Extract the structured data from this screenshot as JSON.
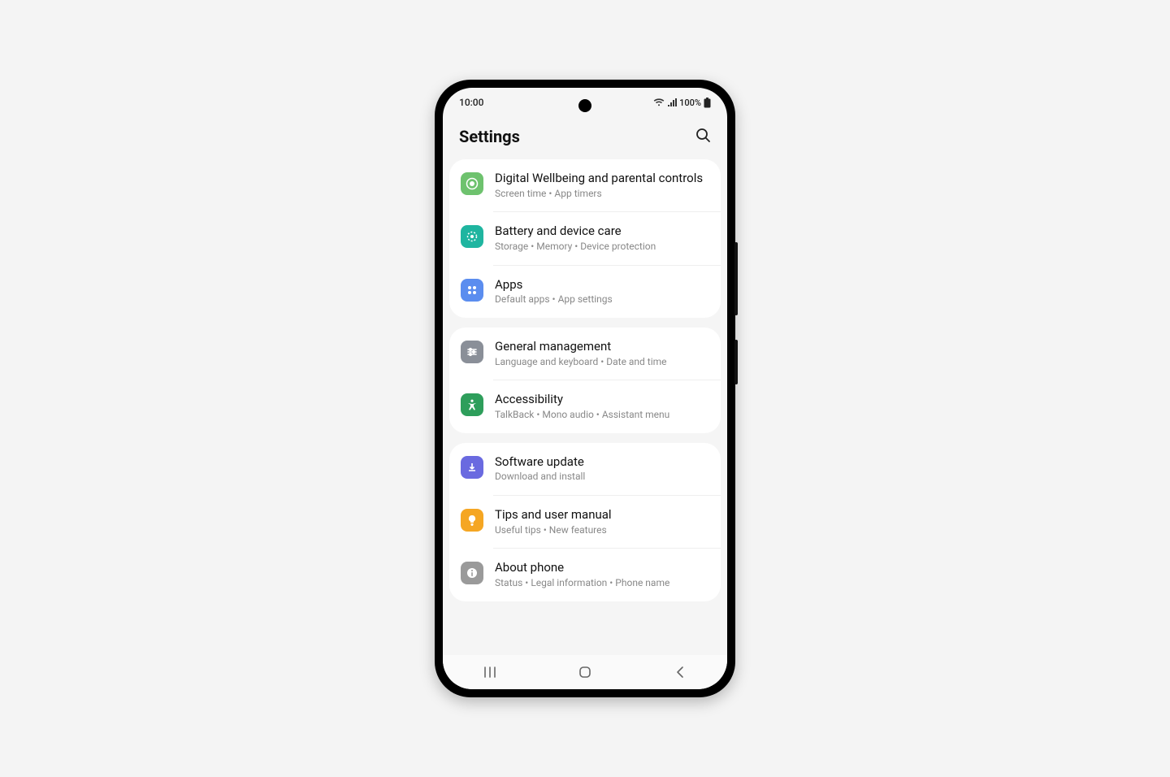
{
  "status": {
    "time": "10:00",
    "battery": "100%"
  },
  "header": {
    "title": "Settings"
  },
  "groups": [
    {
      "items": [
        {
          "id": "wellbeing",
          "title": "Digital Wellbeing and parental controls",
          "sub": "Screen time  •  App timers",
          "color": "#6ec26e"
        },
        {
          "id": "battery",
          "title": "Battery and device care",
          "sub": "Storage  •  Memory  •  Device protection",
          "color": "#1fb5a0"
        },
        {
          "id": "apps",
          "title": "Apps",
          "sub": "Default apps  •  App settings",
          "color": "#5b8def"
        }
      ]
    },
    {
      "items": [
        {
          "id": "general",
          "title": "General management",
          "sub": "Language and keyboard  •  Date and time",
          "color": "#8a8f98"
        },
        {
          "id": "accessibility",
          "title": "Accessibility",
          "sub": "TalkBack  •  Mono audio  •  Assistant menu",
          "color": "#2e9e5b"
        }
      ]
    },
    {
      "items": [
        {
          "id": "update",
          "title": "Software update",
          "sub": "Download and install",
          "color": "#6a6ae0"
        },
        {
          "id": "tips",
          "title": "Tips and user manual",
          "sub": "Useful tips  •  New features",
          "color": "#f5a623"
        },
        {
          "id": "about",
          "title": "About phone",
          "sub": "Status  •  Legal information  •  Phone name",
          "color": "#9a9a9a"
        }
      ]
    }
  ]
}
